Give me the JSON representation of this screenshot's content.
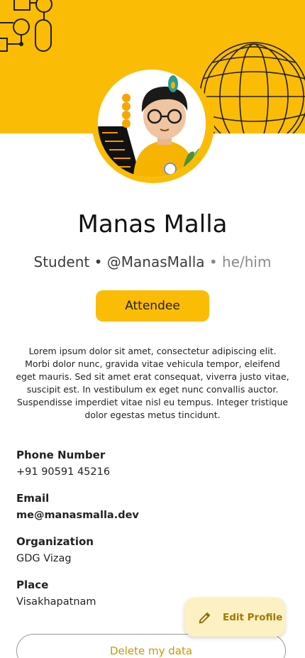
{
  "profile": {
    "name": "Manas Malla",
    "role": "Student",
    "separator": " • ",
    "handle": "@ManasMalla",
    "pronouns_prefix": " • ",
    "pronouns": "he/him",
    "badge": "Attendee",
    "bio": "Lorem ipsum dolor sit amet, consectetur adipiscing elit. Morbi dolor nunc, gravida vitae vehicula tempor, eleifend eget mauris. Sed sit amet erat consequat, viverra justo vitae, suscipit est. In vestibulum ex eget nunc convallis auctor. Suspendisse imperdiet vitae nisl eu tempus. Integer tristique dolor egestas metus tincidunt."
  },
  "details": [
    {
      "label": "Phone Number",
      "value": "+91 90591 45216"
    },
    {
      "label": "Email",
      "value": "me@manasmalla.dev"
    },
    {
      "label": "Organization",
      "value": "GDG Vizag"
    },
    {
      "label": "Place",
      "value": "Visakhapatnam"
    }
  ],
  "actions": {
    "edit_label": "Edit Profile",
    "edit_icon": "pencil-icon",
    "delete_label": "Delete my data"
  },
  "colors": {
    "accent": "#fbbc05",
    "edit_bg": "#fdf0c2",
    "edit_text": "#a07a00",
    "delete_text": "#c79a00"
  }
}
